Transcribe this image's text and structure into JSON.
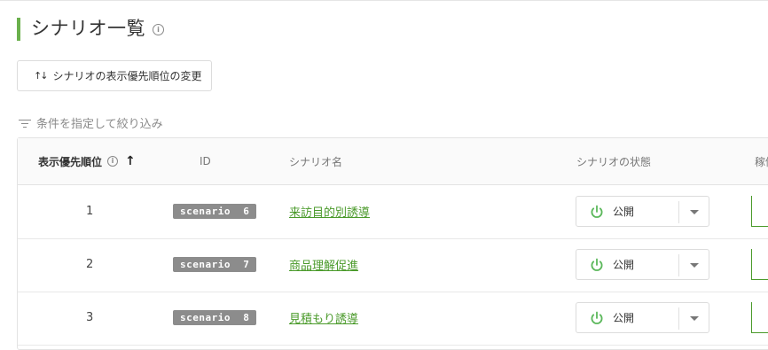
{
  "page": {
    "title": "シナリオ一覧",
    "info_icon": "info-icon",
    "accent_color": "#6ab04c"
  },
  "toolbar": {
    "priority_button_label": "シナリオの表示優先順位の変更",
    "priority_button_icon": "sort-arrows-icon"
  },
  "filter": {
    "label": "条件を指定して絞り込み",
    "icon": "filter-icon"
  },
  "table": {
    "columns": {
      "priority": "表示優先順位",
      "id": "ID",
      "name": "シナリオ名",
      "status": "シナリオの状態",
      "extra": "稼働"
    },
    "sort_direction": "↑",
    "rows": [
      {
        "priority": "1",
        "id": "scenario  6",
        "name": "来訪目的別誘導",
        "status": "公開"
      },
      {
        "priority": "2",
        "id": "scenario  7",
        "name": "商品理解促進",
        "status": "公開"
      },
      {
        "priority": "3",
        "id": "scenario  8",
        "name": "見積もり誘導",
        "status": "公開"
      }
    ]
  },
  "colors": {
    "link": "#4a9a2a",
    "badge": "#8c8c8c",
    "status_icon": "#5cb85c"
  }
}
